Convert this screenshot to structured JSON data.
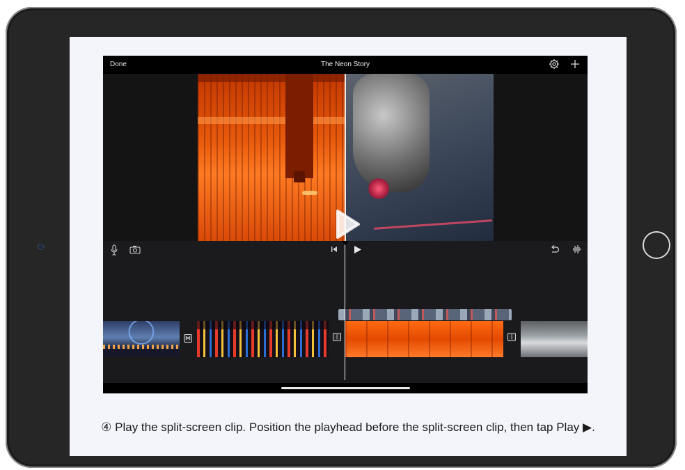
{
  "app": {
    "done_label": "Done",
    "project_title": "The Neon Story"
  },
  "icons": {
    "settings": "gear-icon",
    "add": "plus-icon",
    "microphone": "microphone-icon",
    "camera": "camera-icon",
    "skip_to_start": "skip-to-start-icon",
    "play": "play-icon",
    "undo": "undo-icon",
    "audio": "audio-waveform-icon",
    "transition": "transition-icon"
  },
  "timeline": {
    "clips": [
      "ferris-wheel-clip",
      "neon-street-clip",
      "laser-orange-clip",
      "laser-silver-clip"
    ]
  },
  "caption": {
    "text": "④ Play the split-screen clip. Position the playhead before the split-screen clip, then tap Play ▶."
  },
  "colors": {
    "app_background": "#141414",
    "accent_text": "#ffffff"
  }
}
